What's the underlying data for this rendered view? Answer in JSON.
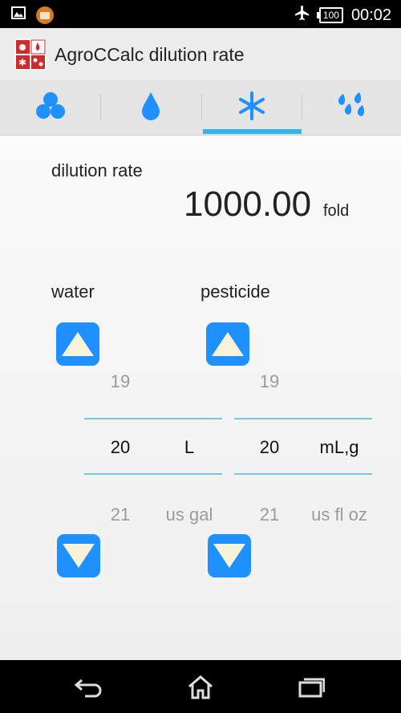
{
  "status_bar": {
    "icons_left": [
      "image-icon",
      "folder-app-icon"
    ],
    "icons_right": [
      "airplane-mode-icon",
      "battery-icon"
    ],
    "battery_level": "100",
    "time": "00:02"
  },
  "app_bar": {
    "title": "AgroCCalc dilution rate",
    "icon": "agrocalc-app-icon"
  },
  "tabs": [
    {
      "icon": "cluster-icon",
      "selected": false
    },
    {
      "icon": "drop-icon",
      "selected": false
    },
    {
      "icon": "asterisk-icon",
      "selected": true
    },
    {
      "icon": "droplets-icon",
      "selected": false
    }
  ],
  "colors": {
    "accent": "#1e90ff",
    "indicator": "#33b5e5",
    "rule": "#78c6e6"
  },
  "result": {
    "label": "dilution rate",
    "value": "1000.00",
    "unit": "fold"
  },
  "water": {
    "label": "water",
    "prev": "19",
    "value": "20",
    "next": "21",
    "unit": "L",
    "unit_next": "us gal"
  },
  "pesticide": {
    "label": "pesticide",
    "prev": "19",
    "value": "20",
    "next": "21",
    "unit": "mL,g",
    "unit_next": "us fl oz"
  },
  "nav_bar": [
    "back-icon",
    "home-icon",
    "recent-apps-icon"
  ]
}
